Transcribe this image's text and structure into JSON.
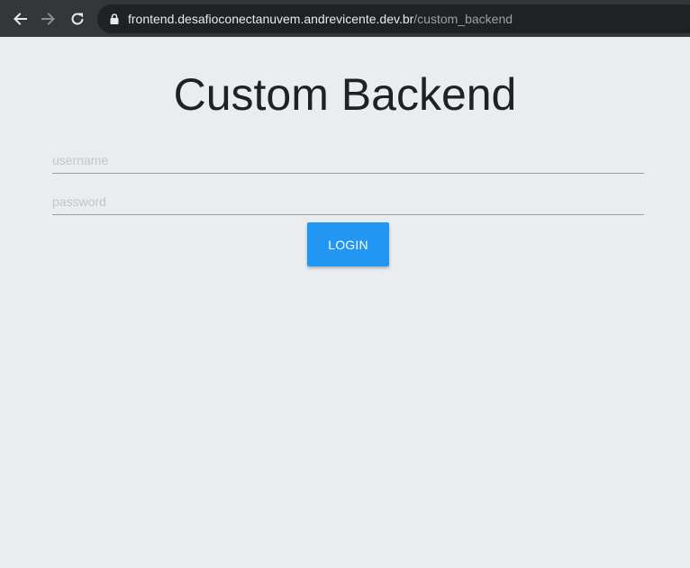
{
  "browser": {
    "url_host": "frontend.desafioconectanuvem.andrevicente.dev.br",
    "url_path": "/custom_backend",
    "icons": {
      "back": "arrow-left-icon",
      "forward": "arrow-right-icon",
      "reload": "reload-icon",
      "lock": "lock-icon"
    },
    "colors": {
      "toolbar": "#35363a",
      "omnibox": "#202124"
    }
  },
  "page": {
    "title": "Custom Backend",
    "username_placeholder": "username",
    "password_placeholder": "password",
    "login_label": "LOGIN",
    "colors": {
      "background": "#e9edf0",
      "button": "#2196f3"
    }
  }
}
